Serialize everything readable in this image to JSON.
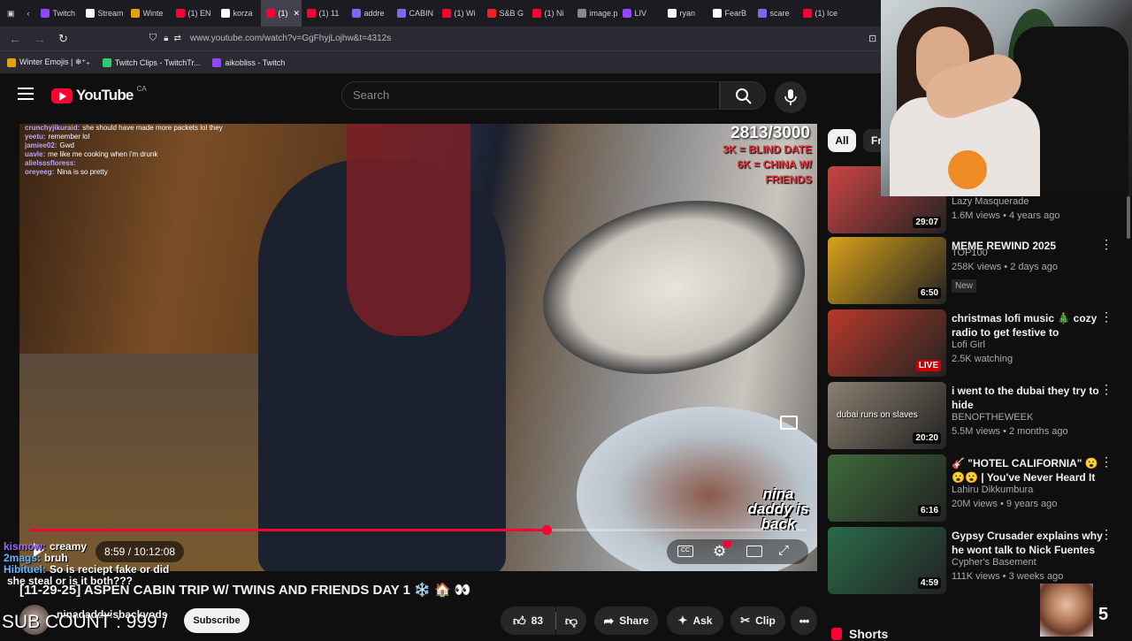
{
  "browser": {
    "tabs": [
      {
        "label": "Twitch",
        "color": "#9146ff"
      },
      {
        "label": "Stream",
        "color": "#ffffff"
      },
      {
        "label": "Winte",
        "color": "#e5a00d"
      },
      {
        "label": "(1) EN",
        "color": "#ff0033"
      },
      {
        "label": "korza",
        "color": "#ffffff"
      },
      {
        "label": "(1)",
        "color": "#ff0033"
      },
      {
        "label": "(1) 11",
        "color": "#ff0033"
      },
      {
        "label": "addre",
        "color": "#7b68ee"
      },
      {
        "label": "CABIN",
        "color": "#7b68ee"
      },
      {
        "label": "(1) Wi",
        "color": "#ff0033"
      },
      {
        "label": "S&B G",
        "color": "#e22"
      },
      {
        "label": "(1) Ni",
        "color": "#ff0033"
      },
      {
        "label": "image.png",
        "color": "#888888"
      },
      {
        "label": "LIV",
        "color": "#9146ff"
      },
      {
        "label": "ryan",
        "color": "#ffffff"
      },
      {
        "label": "FearB",
        "color": "#ffffff"
      },
      {
        "label": "scare",
        "color": "#7b68ee"
      },
      {
        "label": "(1) Ice",
        "color": "#ff0033"
      }
    ],
    "url": "www.youtube.com/watch?v=GgFhyjLojhw&t=4312s",
    "bookmarks": [
      {
        "label": "Winter Emojis | ❄︎⁺₊",
        "color": "#e5a00d"
      },
      {
        "label": "Twitch Clips - TwitchTr...",
        "color": "#2ecc71"
      },
      {
        "label": "aikobliss - Twitch",
        "color": "#9146ff"
      }
    ]
  },
  "youtube": {
    "logo_text": "YouTube",
    "country": "CA",
    "search_placeholder": "Search"
  },
  "video": {
    "overlay_count": "2813/3000",
    "goal_line1": "3K = BLIND DATE",
    "goal_line2": "6K = CHINA W/",
    "goal_line3": "FRIENDS",
    "chat": [
      {
        "user": "crunchyjikuraid:",
        "msg": "she should have made more packets lol they"
      },
      {
        "user": "yeetu:",
        "msg": "remember lol"
      },
      {
        "user": "jamiee02:",
        "msg": "Gwd"
      },
      {
        "user": "uavle:",
        "msg": "me like me cooking when i'm drunk"
      },
      {
        "user": "alielsssfloress:",
        "msg": ""
      },
      {
        "user": "oreyeeg:",
        "msg": "Nina is so pretty"
      }
    ],
    "time": "8:59 / 10:12:08",
    "progress": 0.665,
    "watermark": "nina daddy is back"
  },
  "stream_chat": [
    {
      "user": "kismow:",
      "msg": "creamy"
    },
    {
      "user": "2mags:",
      "msg": "bruh"
    },
    {
      "user": "Hibituel:",
      "msg": "So is reciept fake or did"
    },
    {
      "user": "",
      "msg": "she steal or is it both???"
    }
  ],
  "title": "[11-29-25] ASPEN CABIN TRIP W/ TWINS AND FRIENDS DAY 1 ❄️ 🏠 👀",
  "channel": "ninadaddyisbackyods",
  "sub_count_overlay": "SUB COUNT : 999 /",
  "subscribe": "Subscribe",
  "actions": {
    "likes": "83",
    "share": "Share",
    "ask": "Ask",
    "clip": "Clip"
  },
  "chips": [
    "All",
    "Fr"
  ],
  "recommendations": [
    {
      "title": "",
      "channel": "Lazy Masquerade",
      "meta": "1.6M views • 4 years ago",
      "duration": "29:07",
      "badge": "",
      "thumb": "#c44"
    },
    {
      "title": "MEME REWIND 2025",
      "channel": "TOP100",
      "meta": "258K views • 2 days ago",
      "duration": "6:50",
      "badge": "New",
      "thumb": "#d9a21b"
    },
    {
      "title": "christmas lofi music 🎄 cozy radio to get festive to",
      "channel": "Lofi Girl",
      "meta": "2.5K watching",
      "duration": "LIVE",
      "badge": "",
      "thumb": "#b83a2a"
    },
    {
      "title": "i went to the dubai they try to hide",
      "channel": "BENOFTHEWEEK",
      "meta": "5.5M views • 2 months ago",
      "duration": "20:20",
      "badge": "",
      "thumb": "#8a8070",
      "overlay": "dubai runs on slaves"
    },
    {
      "title": "🎸 \"HOTEL CALIFORNIA\" 😮😮😮 | You've Never Heard It Lik...",
      "channel": "Lahiru Dikkumbura",
      "meta": "20M views • 9 years ago",
      "duration": "6:16",
      "badge": "",
      "thumb": "#3d6b3a"
    },
    {
      "title": "Gypsy Crusader explains why he wont talk to Nick Fuentes whil...",
      "channel": "Cypher's Basement",
      "meta": "111K views • 3 weeks ago",
      "duration": "4:59",
      "badge": "",
      "thumb": "#2a6a4a"
    }
  ],
  "shorts_label": "Shorts",
  "webcam_badge": "5"
}
